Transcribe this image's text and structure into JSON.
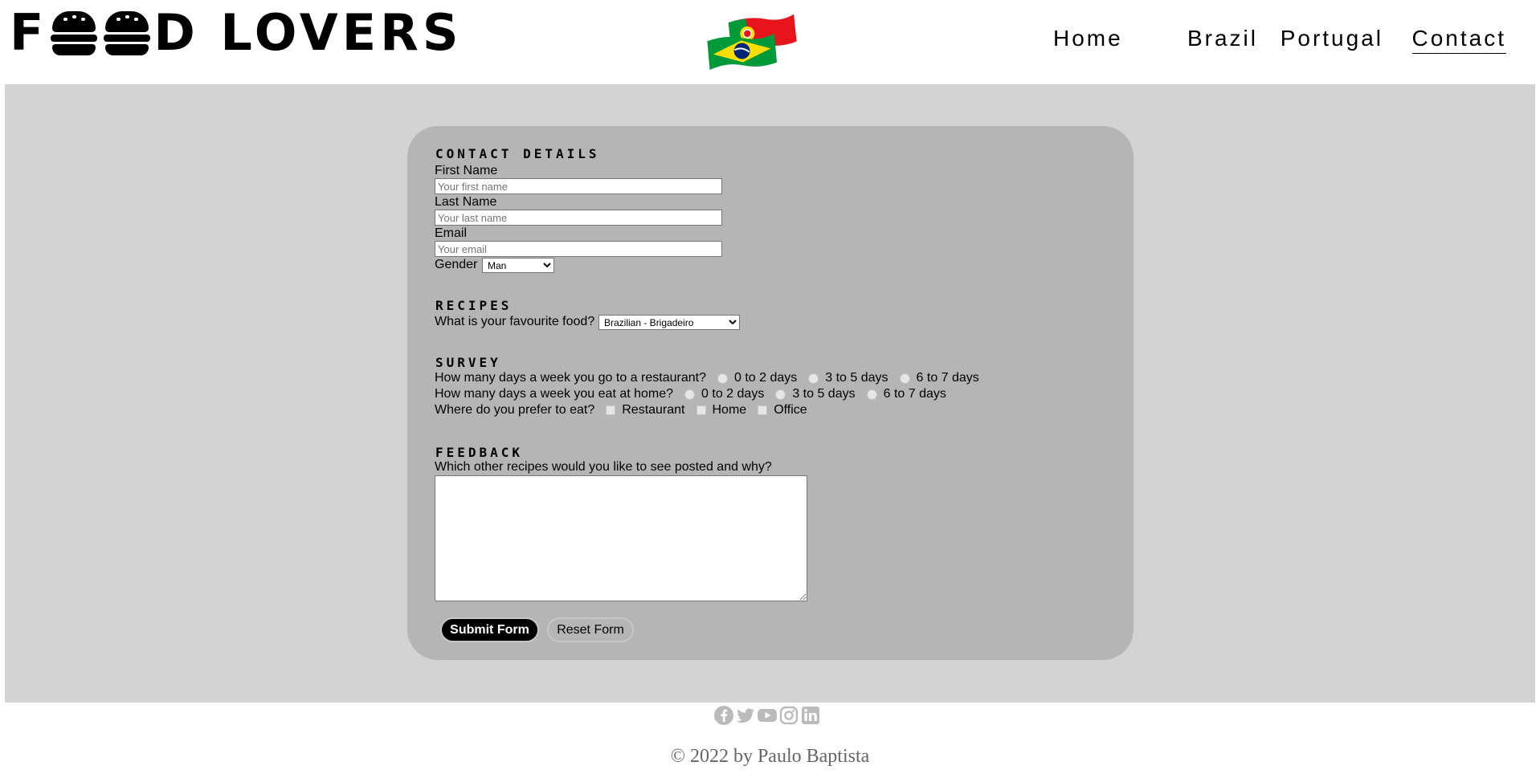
{
  "header": {
    "logo": {
      "first_letter": "F",
      "rest": "D LOVERS"
    },
    "nav": [
      {
        "label": "Home"
      },
      {
        "label": "Brazil"
      },
      {
        "label": "Portugal"
      },
      {
        "label": "Contact",
        "active": true
      }
    ]
  },
  "form": {
    "contact": {
      "title": "CONTACT DETAILS",
      "first_name_label": "First Name",
      "first_name_placeholder": "Your first name",
      "last_name_label": "Last Name",
      "last_name_placeholder": "Your last name",
      "email_label": "Email",
      "email_placeholder": "Your email",
      "gender_label": "Gender",
      "gender_value": "Man"
    },
    "recipes": {
      "title": "RECIPES",
      "question": "What is your favourite food?",
      "food_value": "Brazilian - Brigadeiro"
    },
    "survey": {
      "title": "SURVEY",
      "restaurant_question": "How many days a week you go to a restaurant?",
      "home_question": "How many days a week you eat at home?",
      "options": [
        "0 to 2 days",
        "3 to 5 days",
        "6 to 7 days"
      ],
      "place_question": "Where do you prefer to eat?",
      "places": [
        "Restaurant",
        "Home",
        "Office"
      ]
    },
    "feedback": {
      "title": "FEEDBACK",
      "question": "Which other recipes would you like to see posted and why?"
    },
    "submit_label": "Submit Form",
    "reset_label": "Reset Form"
  },
  "footer": {
    "social_icons": [
      "facebook-icon",
      "twitter-icon",
      "youtube-icon",
      "instagram-icon",
      "linkedin-icon"
    ],
    "icon_color": "#bbbbbb",
    "copyright": "© 2022 by Paulo Baptista"
  },
  "colors": {
    "page_band": "#d3d3d3",
    "form_card": "#b5b5b5",
    "submit_bg": "#000000",
    "flag_red": "#e8141c",
    "flag_green": "#009a3b",
    "flag_yellow": "#fedd00"
  }
}
